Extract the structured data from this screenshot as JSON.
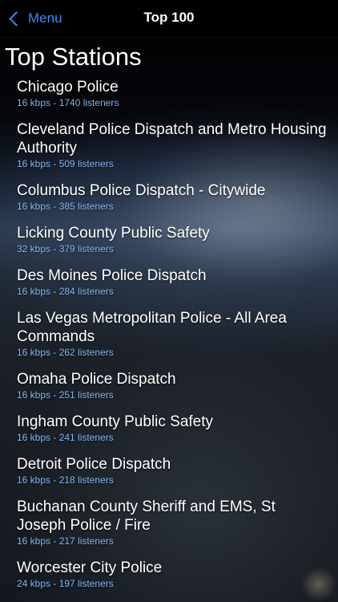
{
  "nav": {
    "back_label": "Menu",
    "title": "Top 100"
  },
  "heading": "Top Stations",
  "stations": [
    {
      "name": "Chicago Police",
      "meta": "16 kbps - 1740 listeners"
    },
    {
      "name": "Cleveland Police Dispatch and Metro Housing Authority",
      "meta": "16 kbps - 509 listeners"
    },
    {
      "name": "Columbus Police Dispatch - Citywide",
      "meta": "16 kbps - 385 listeners"
    },
    {
      "name": "Licking County Public Safety",
      "meta": "32 kbps - 379 listeners"
    },
    {
      "name": "Des Moines Police Dispatch",
      "meta": "16 kbps - 284 listeners"
    },
    {
      "name": "Las Vegas Metropolitan Police - All Area Commands",
      "meta": "16 kbps - 262 listeners"
    },
    {
      "name": "Omaha Police Dispatch",
      "meta": "16 kbps - 251 listeners"
    },
    {
      "name": "Ingham County Public Safety",
      "meta": "16 kbps - 241 listeners"
    },
    {
      "name": "Detroit Police Dispatch",
      "meta": "16 kbps - 218 listeners"
    },
    {
      "name": "Buchanan County Sheriff and EMS, St Joseph Police / Fire",
      "meta": "16 kbps - 217 listeners"
    },
    {
      "name": "Worcester City Police",
      "meta": "24 kbps - 197 listeners"
    }
  ],
  "colors": {
    "accent": "#3b8cf7",
    "meta_text": "#7fb6f2",
    "primary_text": "#ffffff"
  },
  "icons": {
    "back": "chevron-left-icon"
  }
}
